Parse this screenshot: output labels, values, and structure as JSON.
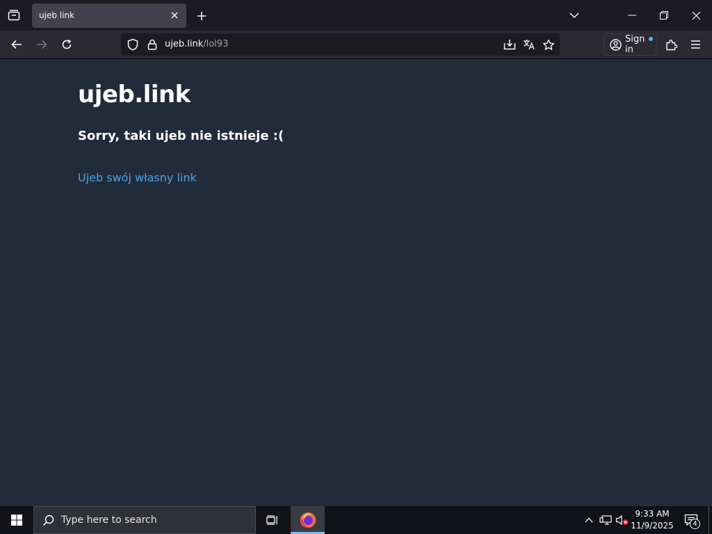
{
  "browser": {
    "tab": {
      "title": "ujeb link"
    },
    "url": {
      "host": "ujeb.link",
      "path": "/lol93"
    },
    "signin_label": "Sign in"
  },
  "page": {
    "site_title": "ujeb.link",
    "error_message": "Sorry, taki ujeb nie istnieje :(",
    "create_link": "Ujeb swój własny link"
  },
  "taskbar": {
    "search_placeholder": "Type here to search",
    "time": "9:33 AM",
    "date": "11/9/2025",
    "notification_count": "4"
  },
  "colors": {
    "page_background": "#222b3a",
    "link": "#4aa3e8",
    "toolbar": "#2b2a33",
    "tabstrip": "#1c1b22"
  },
  "icons": [
    "tab-list-icon",
    "close-icon",
    "plus-icon",
    "chevron-down-icon",
    "minimize-icon",
    "restore-icon",
    "back-arrow-icon",
    "forward-arrow-icon",
    "reload-icon",
    "shield-icon",
    "lock-icon",
    "save-page-icon",
    "translate-icon",
    "star-icon",
    "account-icon",
    "extensions-icon",
    "hamburger-menu-icon",
    "windows-logo-icon",
    "search-icon",
    "task-view-icon",
    "firefox-icon",
    "chevron-up-icon",
    "network-icon",
    "volume-muted-icon",
    "notifications-icon"
  ]
}
